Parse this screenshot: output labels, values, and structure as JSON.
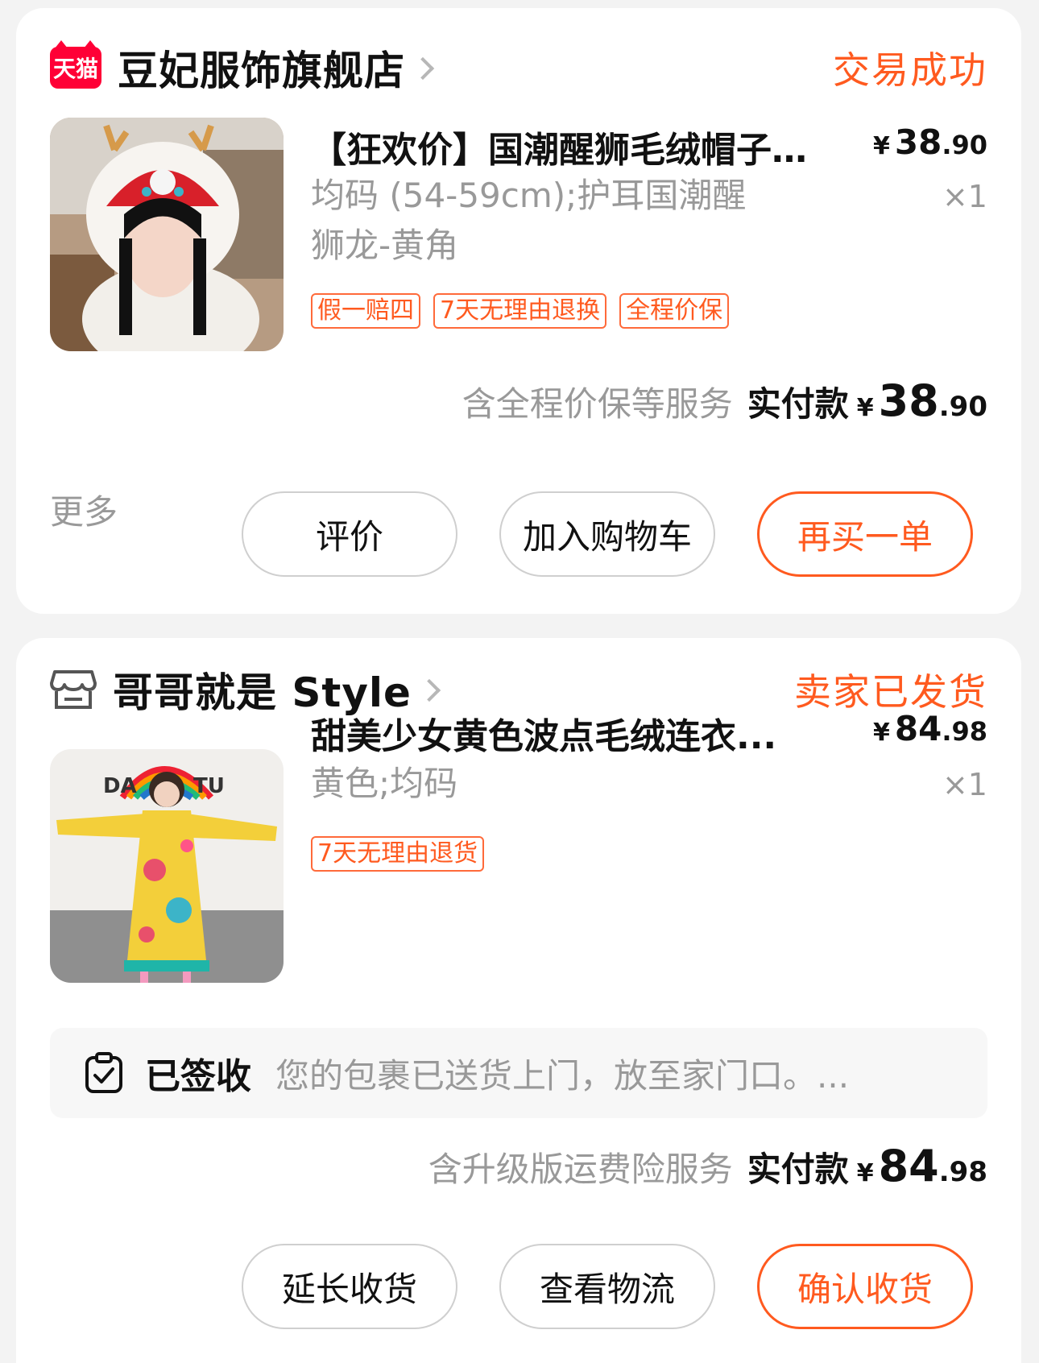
{
  "orders": [
    {
      "shop": {
        "badge": "天猫",
        "name": "豆妃服饰旗舰店",
        "status": "交易成功"
      },
      "item": {
        "title": "【狂欢价】国潮醒狮毛绒帽子...",
        "price_yen": "¥",
        "price_int": "38",
        "price_dec": ".90",
        "spec_line1": "均码 (54-59cm);护耳国潮醒",
        "spec_line2": "狮龙-黄角",
        "qty": "×1",
        "tags": [
          "假一赔四",
          "7天无理由退换",
          "全程价保"
        ]
      },
      "payment": {
        "note": "含全程价保等服务",
        "label": "实付款",
        "yen": "¥",
        "int": "38",
        "dec": ".90"
      },
      "actions": {
        "more": "更多",
        "b1": "评价",
        "b2": "加入购物车",
        "b3": "再买一单"
      }
    },
    {
      "shop": {
        "name": "哥哥就是 Style",
        "status": "卖家已发货"
      },
      "item": {
        "title": "甜美少女黄色波点毛绒连衣...",
        "price_yen": "¥",
        "price_int": "84",
        "price_dec": ".98",
        "spec_line1": "黄色;均码",
        "qty": "×1",
        "tags": [
          "7天无理由退货"
        ],
        "image_text_left": "DA",
        "image_text_right": "TU"
      },
      "logistics": {
        "status": "已签收",
        "text": "您的包裹已送货上门，放至家门口。..."
      },
      "payment": {
        "note": "含升级版运费险服务",
        "label": "实付款",
        "yen": "¥",
        "int": "84",
        "dec": ".98"
      },
      "actions": {
        "b1": "延长收货",
        "b2": "查看物流",
        "b3": "确认收货"
      }
    }
  ],
  "colors": {
    "accent": "#ff5a1f",
    "tmall": "#ff0036",
    "muted": "#999999",
    "bg": "#f3f3f3"
  },
  "icons": [
    "tmall-badge",
    "chevron-right-icon",
    "store-icon",
    "clipboard-check-icon"
  ]
}
